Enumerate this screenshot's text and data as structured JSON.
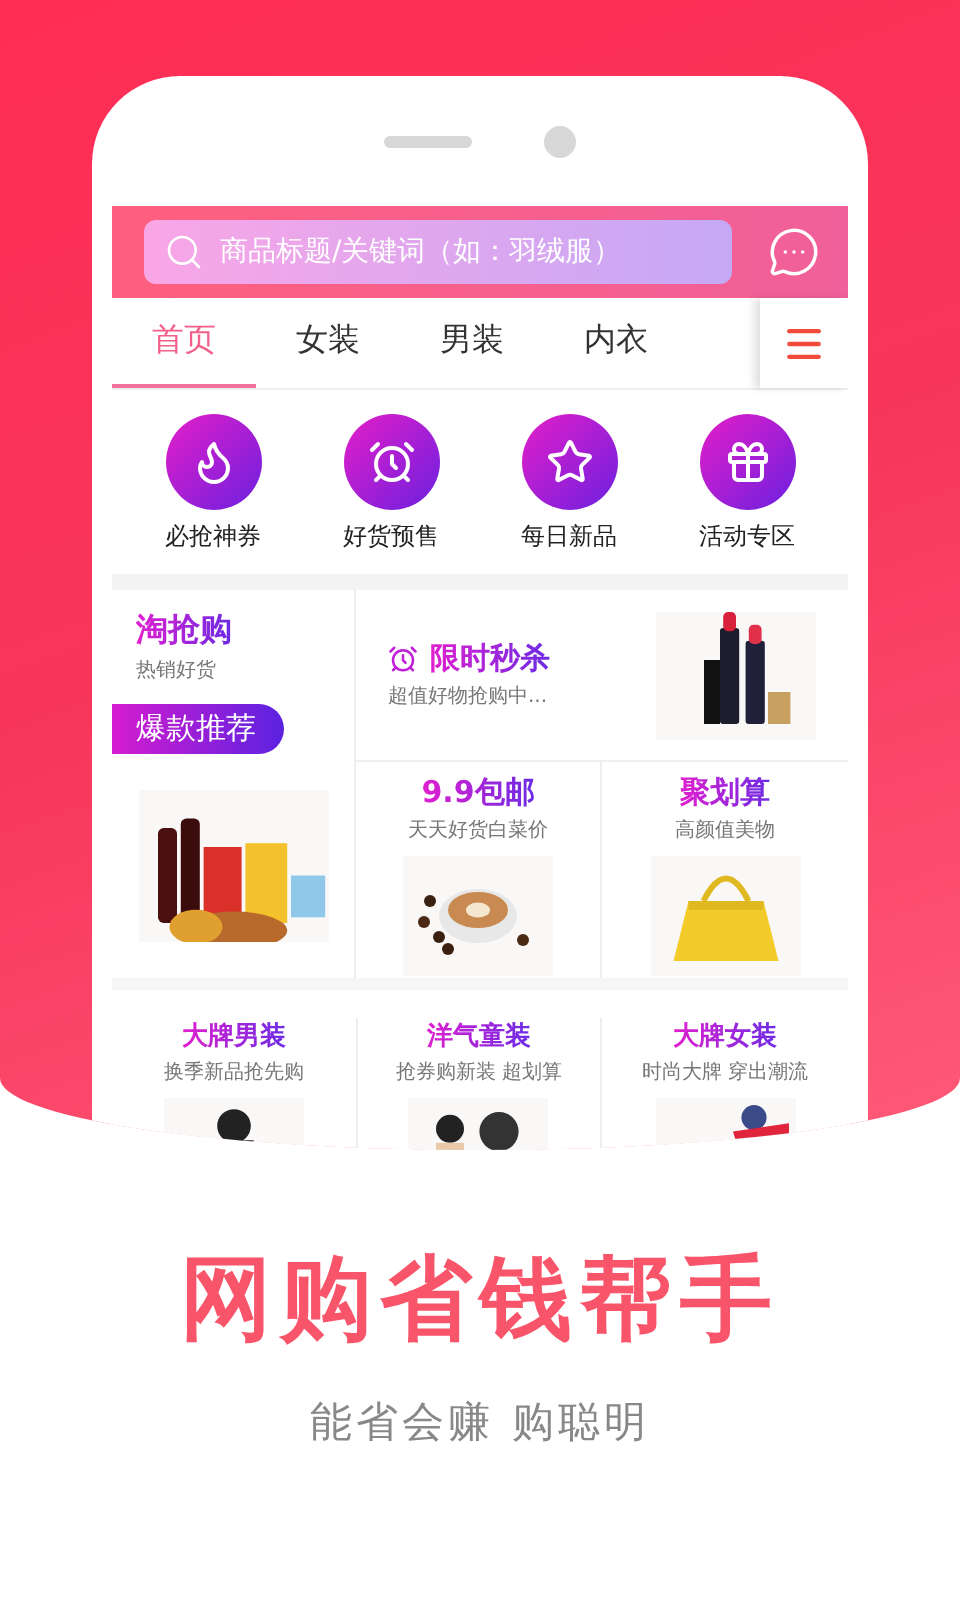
{
  "search": {
    "placeholder": "商品标题/关键词（如：羽绒服）"
  },
  "tabs": [
    {
      "label": "首页",
      "selected": true
    },
    {
      "label": "女装",
      "selected": false
    },
    {
      "label": "男装",
      "selected": false
    },
    {
      "label": "内衣",
      "selected": false
    }
  ],
  "shortcuts": [
    {
      "label": "必抢神券",
      "kind": "flame"
    },
    {
      "label": "好货预售",
      "kind": "alarm"
    },
    {
      "label": "每日新品",
      "kind": "star"
    },
    {
      "label": "活动专区",
      "kind": "gift"
    }
  ],
  "promo": {
    "main": {
      "title": "淘抢购",
      "subtitle": "热销好货",
      "badge": "爆款推荐"
    },
    "flash": {
      "title": "限时秒杀",
      "subtitle": "超值好物抢购中..."
    },
    "tiles": [
      {
        "title": "9.9包邮",
        "subtitle": "天天好货白菜价"
      },
      {
        "title": "聚划算",
        "subtitle": "高颜值美物"
      }
    ]
  },
  "brands": [
    {
      "title": "大牌男装",
      "subtitle": "换季新品抢先购"
    },
    {
      "title": "洋气童装",
      "subtitle": "抢券购新装 超划算"
    },
    {
      "title": "大牌女装",
      "subtitle": "时尚大牌 穿出潮流"
    }
  ],
  "headline": "网购省钱帮手",
  "tagline": "能省会赚 购聪明"
}
